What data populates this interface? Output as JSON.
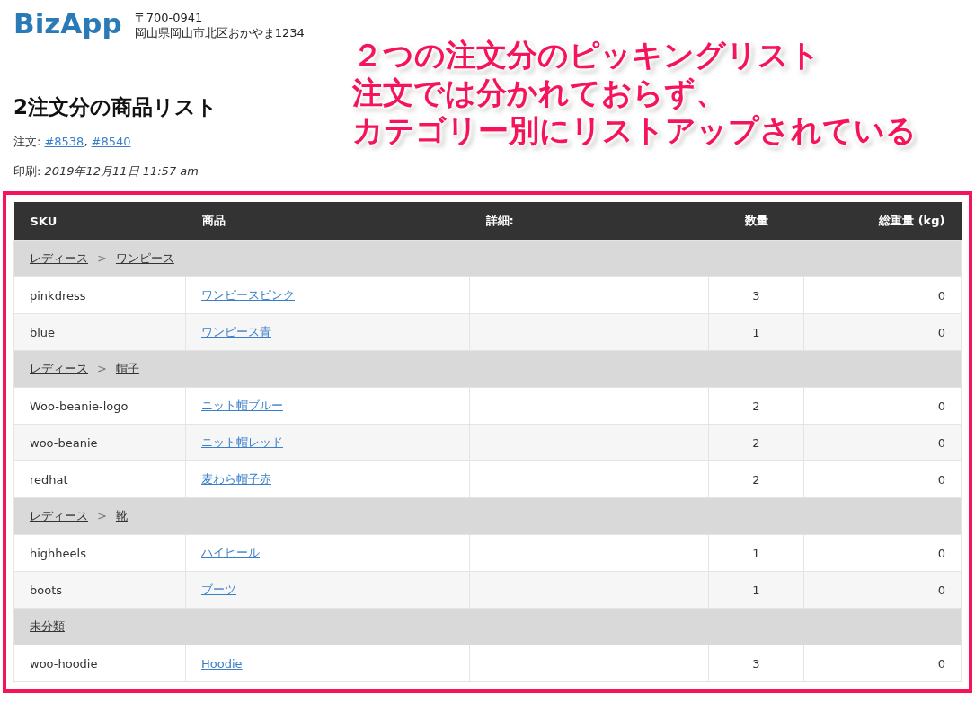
{
  "header": {
    "logo": "BizApp",
    "postal_code": "〒700-0941",
    "address": "岡山県岡山市北区おかやま1234"
  },
  "title": "2注文分の商品リスト",
  "orders": {
    "label": "注文:",
    "links": [
      "#8538",
      "#8540"
    ],
    "separator": ","
  },
  "printed": {
    "label": "印刷:",
    "value": "2019年12月11日 11:57 am"
  },
  "table": {
    "columns": [
      "SKU",
      "商品",
      "詳細:",
      "数量",
      "総重量 (kg)"
    ],
    "rows": [
      {
        "kind": "category",
        "path": [
          "レディース",
          "ワンピース"
        ],
        "separator": ">"
      },
      {
        "kind": "item",
        "sku": "pinkdress",
        "product": "ワンピースピンク",
        "quantity": "3",
        "weight": "0"
      },
      {
        "kind": "item",
        "sku": "blue",
        "product": "ワンピース青",
        "quantity": "1",
        "weight": "0"
      },
      {
        "kind": "category",
        "path": [
          "レディース",
          "帽子"
        ],
        "separator": ">"
      },
      {
        "kind": "item",
        "sku": "Woo-beanie-logo",
        "product": "ニット帽ブルー",
        "quantity": "2",
        "weight": "0"
      },
      {
        "kind": "item",
        "sku": "woo-beanie",
        "product": "ニット帽レッド",
        "quantity": "2",
        "weight": "0"
      },
      {
        "kind": "item",
        "sku": "redhat",
        "product": "麦わら帽子赤",
        "quantity": "2",
        "weight": "0"
      },
      {
        "kind": "category",
        "path": [
          "レディース",
          "靴"
        ],
        "separator": ">"
      },
      {
        "kind": "item",
        "sku": "highheels",
        "product": "ハイヒール",
        "quantity": "1",
        "weight": "0"
      },
      {
        "kind": "item",
        "sku": "boots",
        "product": "ブーツ",
        "quantity": "1",
        "weight": "0"
      },
      {
        "kind": "category",
        "path": [
          "未分類"
        ]
      },
      {
        "kind": "item",
        "sku": "woo-hoodie",
        "product": "Hoodie",
        "quantity": "3",
        "weight": "0"
      }
    ]
  },
  "annotation": {
    "lines": [
      "２つの注文分のピッキングリスト",
      "注文では分かれておらず、",
      "カテゴリー別にリストアップされている"
    ]
  }
}
